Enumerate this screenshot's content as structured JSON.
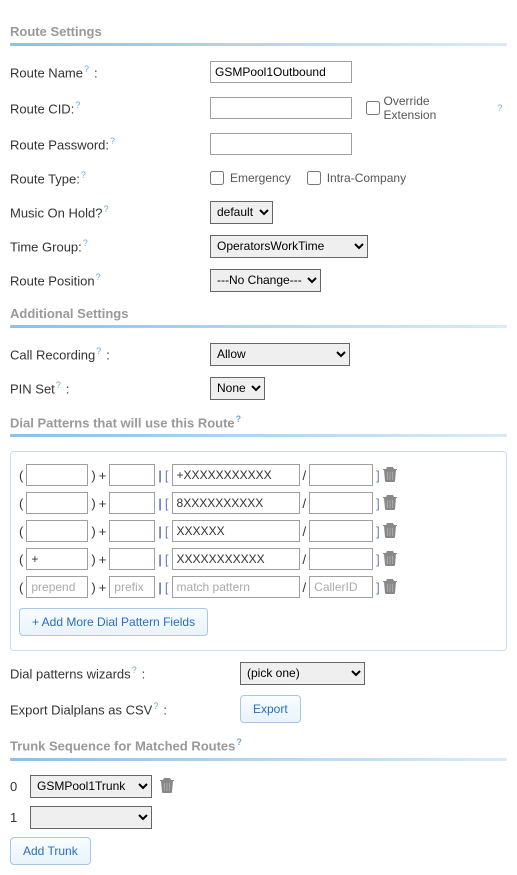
{
  "sections": {
    "route_settings": "Route Settings",
    "additional_settings": "Additional Settings",
    "dial_patterns": "Dial Patterns that will use this Route",
    "trunk_sequence": "Trunk Sequence for Matched Routes"
  },
  "route": {
    "name_label": "Route Name",
    "name_value": "GSMPool1Outbound",
    "cid_label": "Route CID:",
    "cid_value": "",
    "override_label": "Override Extension",
    "password_label": "Route Password:",
    "password_value": "",
    "type_label": "Route Type:",
    "emergency_label": "Emergency",
    "intra_label": "Intra-Company",
    "moh_label": "Music On Hold?",
    "moh_value": "default",
    "time_group_label": "Time Group:",
    "time_group_value": "OperatorsWorkTime",
    "position_label": "Route Position",
    "position_value": "---No Change---"
  },
  "additional": {
    "call_recording_label": "Call Recording",
    "call_recording_value": "Allow",
    "pin_set_label": "PIN Set",
    "pin_set_value": "None"
  },
  "patterns": {
    "rows": [
      {
        "prepend": "",
        "prefix": "",
        "match": "+XXXXXXXXXXX",
        "caller": ""
      },
      {
        "prepend": "",
        "prefix": "",
        "match": "8XXXXXXXXXX",
        "caller": ""
      },
      {
        "prepend": "",
        "prefix": "",
        "match": "XXXXXX",
        "caller": ""
      },
      {
        "prepend": "+",
        "prefix": "",
        "match": "XXXXXXXXXXX",
        "caller": ""
      },
      {
        "prepend": "",
        "prefix": "",
        "match": "",
        "caller": ""
      }
    ],
    "placeholders": {
      "prepend": "prepend",
      "prefix": "prefix",
      "match": "match pattern",
      "caller": "CallerID"
    },
    "add_more_label": "+ Add More Dial Pattern Fields",
    "wizards_label": "Dial patterns wizards",
    "wizards_value": "(pick one)",
    "export_label": "Export Dialplans as CSV",
    "export_button": "Export"
  },
  "trunks": {
    "rows": [
      {
        "index": "0",
        "value": "GSMPool1Trunk",
        "has_trash": true
      },
      {
        "index": "1",
        "value": "",
        "has_trash": false
      }
    ],
    "add_label": "Add Trunk"
  },
  "glyphs": {
    "colon": ":"
  }
}
